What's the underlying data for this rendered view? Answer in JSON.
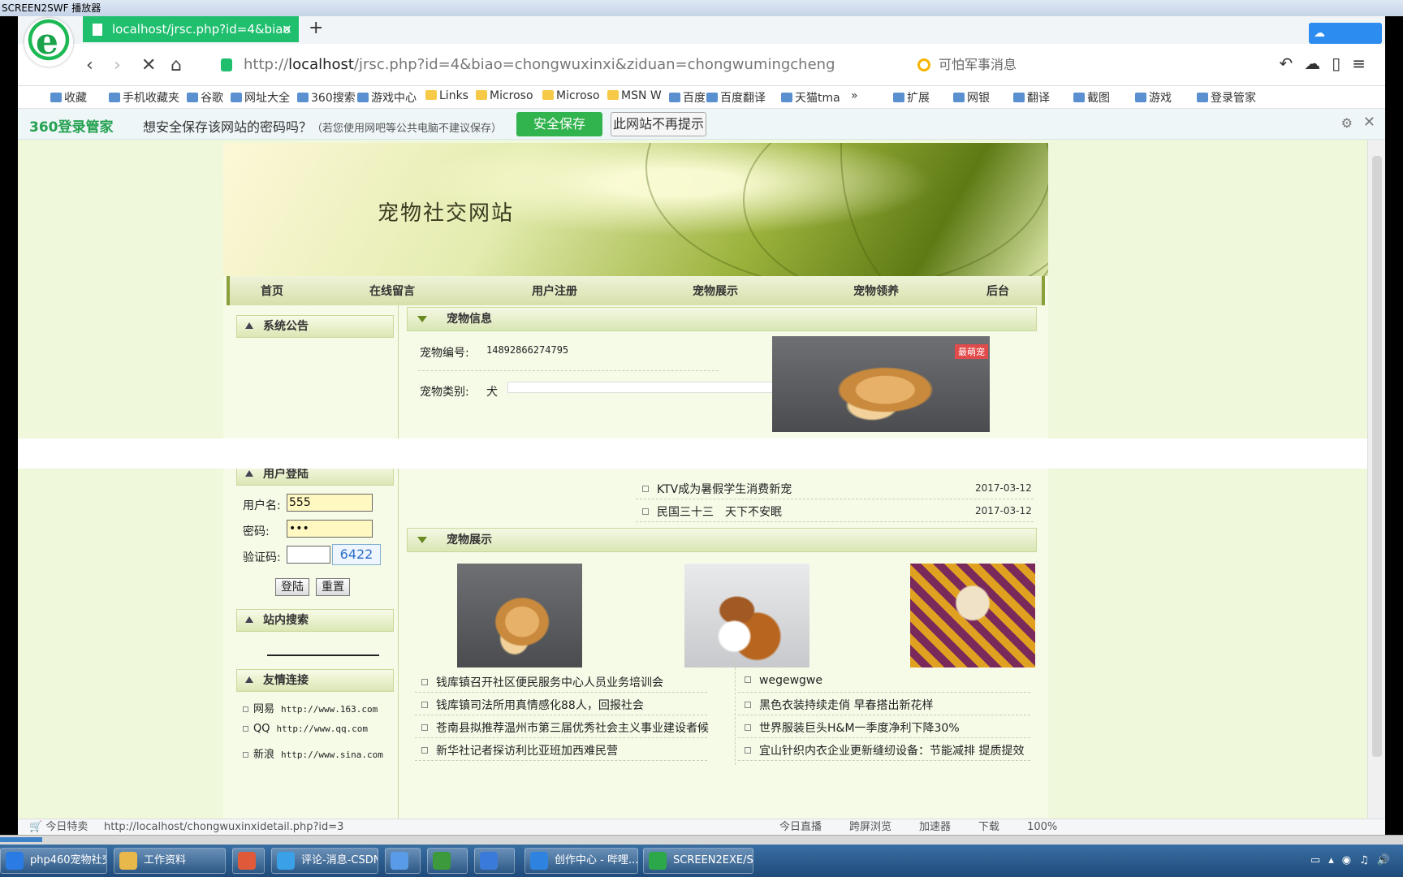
{
  "player": {
    "title": "SCREEN2SWF 播放器"
  },
  "browser": {
    "tab_title": "localhost/jrsc.php?id=4&biao",
    "address_host": "localhost",
    "address_path": "/jrsc.php?id=4&biao=chongwuxinxi&ziduan=chongwumingcheng",
    "search_placeholder": "可怕军事消息",
    "bookmarks": [
      "收藏",
      "手机收藏夹",
      "谷歌",
      "网址大全",
      "360搜索",
      "游戏中心",
      "Links",
      "Microso",
      "Microso",
      "MSN W",
      "百度",
      "百度翻译",
      "天猫tma",
      "»",
      "扩展",
      "网银",
      "翻译",
      "截图",
      "游戏",
      "登录管家"
    ],
    "password_bar": {
      "brand": "360登录管家",
      "question": "想安全保存该网站的密码吗？",
      "note": "（若您使用网吧等公共电脑不建议保存）",
      "save": "安全保存",
      "never": "此网站不再提示"
    },
    "status_left": "今日特卖",
    "status_url": "http://localhost/chongwuxinxidetail.php?id=3",
    "status_right": [
      "今日直播",
      "跨屏浏览",
      "加速器",
      "下载",
      "100%"
    ]
  },
  "site": {
    "title": "宠物社交网站",
    "menu": [
      "首页",
      "在线留言",
      "用户注册",
      "宠物展示",
      "宠物领养",
      "后台"
    ],
    "sidebar": {
      "notice_title": "系统公告",
      "login_title": "用户登陆",
      "username_label": "用户名:",
      "username_value": "555",
      "password_label": "密码:",
      "password_value": "•••",
      "captcha_label": "验证码:",
      "captcha_value": "6422",
      "login_btn": "登陆",
      "reset_btn": "重置",
      "search_title": "站内搜索",
      "links_title": "友情连接",
      "links": [
        {
          "name": "网易",
          "url": "http://www.163.com"
        },
        {
          "name": "QQ",
          "url": "http://www.qq.com"
        },
        {
          "name": "新浪",
          "url": "http://www.sina.com"
        }
      ]
    },
    "info": {
      "heading": "宠物信息",
      "id_label": "宠物编号:",
      "id_value": "14892866274795",
      "type_label": "宠物类别:",
      "type_value": "犬",
      "img_badge": "最萌宠"
    },
    "news_top": [
      {
        "title": "KTV成为暑假学生消费新宠",
        "date": "2017-03-12"
      },
      {
        "title": "民国三十三　天下不安眠",
        "date": "2017-03-12"
      }
    ],
    "show": {
      "heading": "宠物展示",
      "news_left": [
        "钱库镇召开社区便民服务中心人员业务培训会",
        "钱库镇司法所用真情感化88人，回报社会",
        "苍南县拟推荐温州市第三届优秀社会主义事业建设者候",
        "新华社记者探访利比亚班加西难民营"
      ],
      "news_right": [
        "wegewgwe",
        "黑色衣装持续走俏 早春搭出新花样",
        "世界服装巨头H&M一季度净利下降30%",
        "宜山针织内衣企业更新缝纫设备：节能减排 提质提效"
      ]
    }
  },
  "taskbar": {
    "items": [
      "php460宠物社交...",
      "工作资料",
      "",
      "评论-消息-CSDN...",
      "",
      "",
      "",
      "创作中心 - 哔哩...",
      "SCREEN2EXE/S..."
    ],
    "progress": 0.03
  }
}
